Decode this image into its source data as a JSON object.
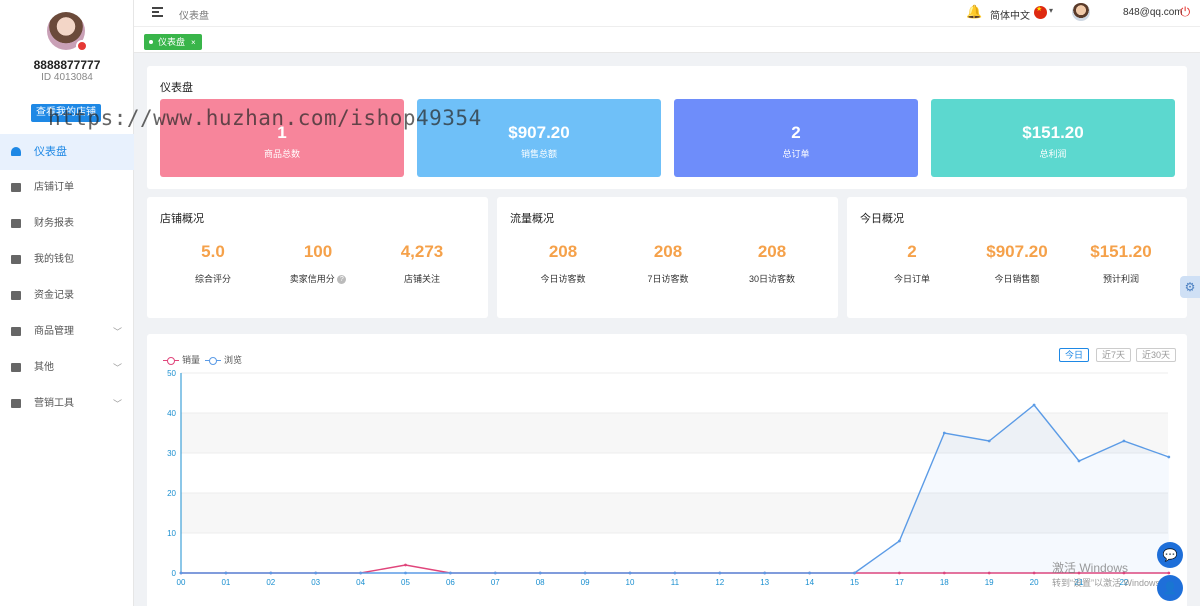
{
  "user": {
    "name": "8888877777",
    "id": "ID 4013084",
    "shop_button": "查看我的店铺"
  },
  "sidebar": {
    "items": [
      {
        "label": "仪表盘",
        "icon": "dashboard-icon",
        "active": true
      },
      {
        "label": "店铺订单",
        "icon": "clipboard-icon"
      },
      {
        "label": "财务报表",
        "icon": "chart-box-icon"
      },
      {
        "label": "我的钱包",
        "icon": "wallet-icon"
      },
      {
        "label": "资金记录",
        "icon": "record-icon"
      },
      {
        "label": "商品管理",
        "icon": "briefcase-icon",
        "chevron": true
      },
      {
        "label": "其他",
        "icon": "grid-icon",
        "chevron": true
      },
      {
        "label": "营销工具",
        "icon": "bar-chart-icon",
        "chevron": true
      }
    ],
    "chevron": "﹀"
  },
  "topbar": {
    "breadcrumb": "仪表盘",
    "language": "简体中文",
    "email": "848@qq.com",
    "bell": "🔔",
    "caret": "▾",
    "power": "⏻"
  },
  "tabs": [
    {
      "label": "仪表盘",
      "close": "×"
    }
  ],
  "dashboard": {
    "title": "仪表盘",
    "cards": [
      {
        "value": "1",
        "label": "商品总数",
        "color": "#f7859b"
      },
      {
        "value": "$907.20",
        "label": "销售总额",
        "color": "#6fc0f8"
      },
      {
        "value": "2",
        "label": "总订单",
        "color": "#6e8dfa"
      },
      {
        "value": "$151.20",
        "label": "总利润",
        "color": "#5cd8cf"
      }
    ]
  },
  "store_overview": {
    "title": "店铺概况",
    "metrics": [
      {
        "value": "5.0",
        "label": "综合评分"
      },
      {
        "value": "100",
        "label": "卖家信用分",
        "help": "?"
      },
      {
        "value": "4,273",
        "label": "店铺关注"
      }
    ]
  },
  "traffic_overview": {
    "title": "流量概况",
    "metrics": [
      {
        "value": "208",
        "label": "今日访客数"
      },
      {
        "value": "208",
        "label": "7日访客数"
      },
      {
        "value": "208",
        "label": "30日访客数"
      }
    ]
  },
  "today_overview": {
    "title": "今日概况",
    "metrics": [
      {
        "value": "2",
        "label": "今日订单"
      },
      {
        "value": "$907.20",
        "label": "今日销售额"
      },
      {
        "value": "$151.20",
        "label": "预计利润"
      }
    ]
  },
  "chart_controls": {
    "buttons": [
      "今日",
      "近7天",
      "近30天"
    ],
    "active_index": 0
  },
  "chart_data": {
    "type": "line",
    "x": [
      "00",
      "01",
      "02",
      "03",
      "04",
      "05",
      "06",
      "07",
      "08",
      "09",
      "10",
      "11",
      "12",
      "13",
      "14",
      "15",
      "17",
      "18",
      "19",
      "20",
      "21",
      "22",
      "23"
    ],
    "x_visible": [
      "00",
      "01",
      "02",
      "03",
      "04",
      "05",
      "06",
      "07",
      "08",
      "09",
      "10",
      "11",
      "12",
      "13",
      "14",
      "15",
      "17",
      "18",
      "19",
      "20",
      "21",
      "22"
    ],
    "series": [
      {
        "name": "销量",
        "color": "#e0457b",
        "values": [
          0,
          0,
          0,
          0,
          0,
          2,
          0,
          0,
          0,
          0,
          0,
          0,
          0,
          0,
          0,
          0,
          0,
          0,
          0,
          0,
          0,
          0,
          0
        ]
      },
      {
        "name": "浏览",
        "color": "#5b9be6",
        "values": [
          0,
          0,
          0,
          0,
          0,
          0,
          0,
          0,
          0,
          0,
          0,
          0,
          0,
          0,
          0,
          0,
          8,
          35,
          33,
          42,
          28,
          33,
          29
        ]
      }
    ],
    "ylim": [
      0,
      50
    ],
    "yticks": [
      0,
      10,
      20,
      30,
      40,
      50
    ],
    "grid": true,
    "legend": "top-left"
  },
  "overlays": {
    "watermark": "https://www.huzhan.com/ishop49354",
    "windows_line1": "激活 Windows",
    "windows_line2": "转到“设置”以激活 Windows。",
    "gear": "⚙",
    "chat": "💬",
    "support": "👤"
  }
}
